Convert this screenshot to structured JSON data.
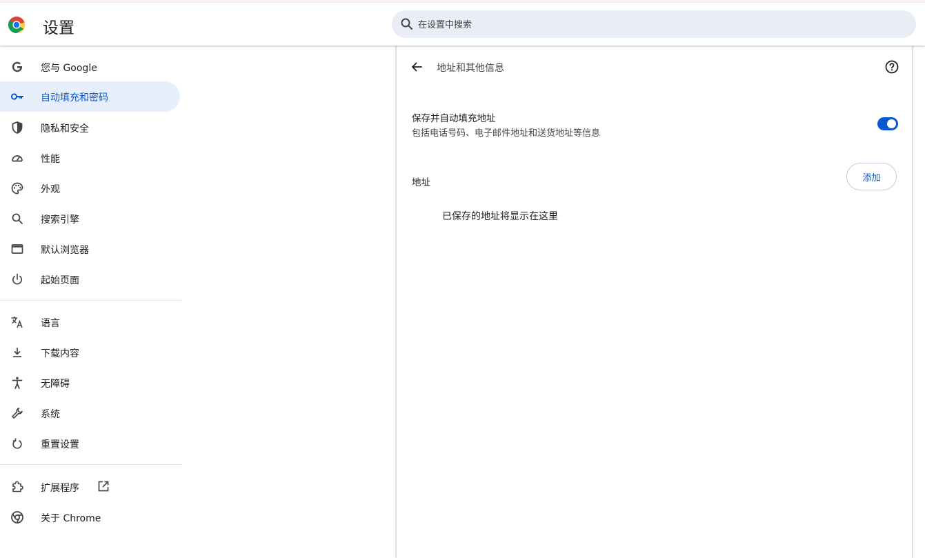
{
  "header": {
    "title": "设置",
    "search_placeholder": "在设置中搜索"
  },
  "sidebar": {
    "items": [
      {
        "label": "您与 Google",
        "icon": "google-g-icon"
      },
      {
        "label": "自动填充和密码",
        "icon": "key-icon",
        "active": true
      },
      {
        "label": "隐私和安全",
        "icon": "shield-icon"
      },
      {
        "label": "性能",
        "icon": "speedometer-icon"
      },
      {
        "label": "外观",
        "icon": "palette-icon"
      },
      {
        "label": "搜索引擎",
        "icon": "search-icon"
      },
      {
        "label": "默认浏览器",
        "icon": "browser-window-icon"
      },
      {
        "label": "起始页面",
        "icon": "power-icon"
      },
      {
        "label": "语言",
        "icon": "translate-icon"
      },
      {
        "label": "下载内容",
        "icon": "download-icon"
      },
      {
        "label": "无障碍",
        "icon": "accessibility-icon"
      },
      {
        "label": "系统",
        "icon": "wrench-icon"
      },
      {
        "label": "重置设置",
        "icon": "reset-icon"
      },
      {
        "label": "扩展程序",
        "icon": "puzzle-icon",
        "external_icon": "open-in-new-icon"
      },
      {
        "label": "关于 Chrome",
        "icon": "chrome-icon"
      }
    ]
  },
  "panel": {
    "title": "地址和其他信息",
    "save_autofill": {
      "title": "保存并自动填充地址",
      "description": "包括电话号码、电子邮件地址和送货地址等信息",
      "enabled": true
    },
    "addresses_label": "地址",
    "add_button": "添加",
    "empty_message": "已保存的地址将显示在这里"
  },
  "colors": {
    "accent": "#0b57d0",
    "active_bg": "#e8effc",
    "search_bg": "#e9eef6"
  }
}
